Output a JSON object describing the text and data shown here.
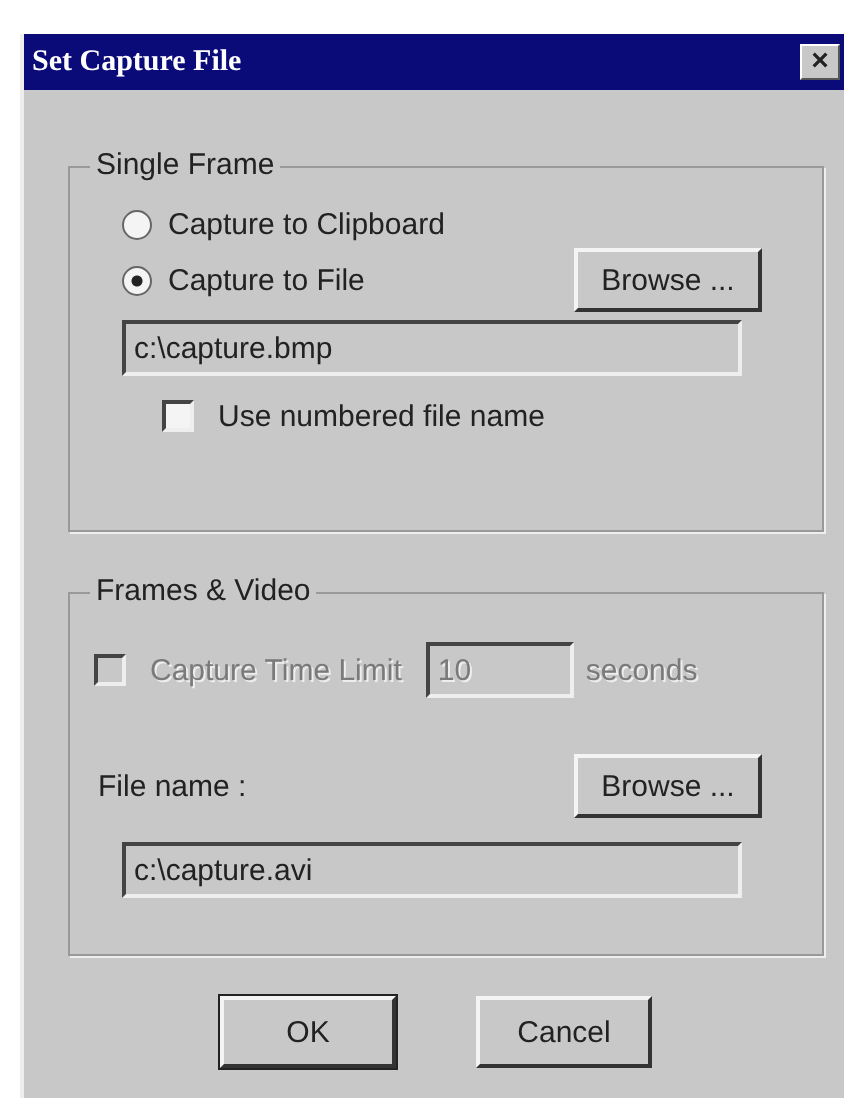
{
  "window": {
    "title": "Set Capture File",
    "close": "×"
  },
  "single_frame": {
    "legend": "Single Frame",
    "options": [
      {
        "label": "Capture to Clipboard",
        "selected": false
      },
      {
        "label": "Capture to File",
        "selected": true
      }
    ],
    "browse": "Browse ...",
    "file_value": "c:\\capture.bmp",
    "numbered": {
      "label": "Use numbered file name",
      "checked": false
    }
  },
  "frames_video": {
    "legend": "Frames & Video",
    "time_limit": {
      "label": "Capture Time Limit",
      "checked": false,
      "disabled": true,
      "value": "10",
      "unit": "seconds"
    },
    "file_label": "File name :",
    "browse": "Browse ...",
    "file_value": "c:\\capture.avi"
  },
  "buttons": [
    "OK",
    "Cancel"
  ]
}
